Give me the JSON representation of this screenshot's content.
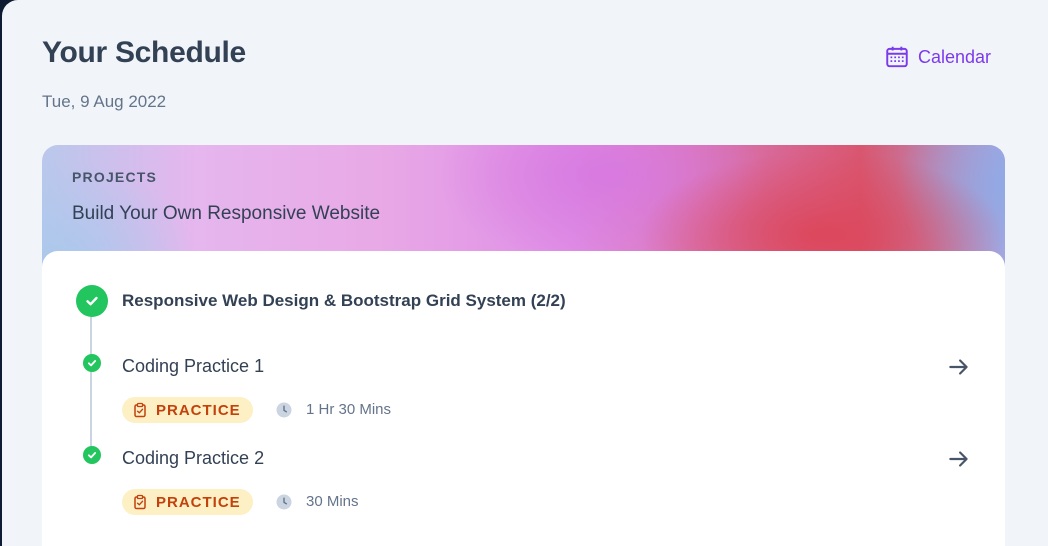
{
  "header": {
    "title": "Your Schedule",
    "date": "Tue, 9 Aug 2022",
    "calendar_label": "Calendar"
  },
  "card": {
    "kicker": "PROJECTS",
    "title": "Build Your Own Responsive Website",
    "section_title": "Responsive Web Design & Bootstrap Grid System (2/2)",
    "items": [
      {
        "title": "Coding Practice 1",
        "badge": "PRACTICE",
        "duration": "1 Hr 30 Mins",
        "completed": true
      },
      {
        "title": "Coding Practice 2",
        "badge": "PRACTICE",
        "duration": "30 Mins",
        "completed": true
      }
    ]
  },
  "colors": {
    "accent": "#7c3aed",
    "success": "#22c55e",
    "badge_bg": "#fdf0c4",
    "badge_text": "#c2410c"
  },
  "icons": [
    "calendar-icon",
    "check-icon",
    "clipboard-check-icon",
    "clock-icon",
    "arrow-right-icon"
  ]
}
